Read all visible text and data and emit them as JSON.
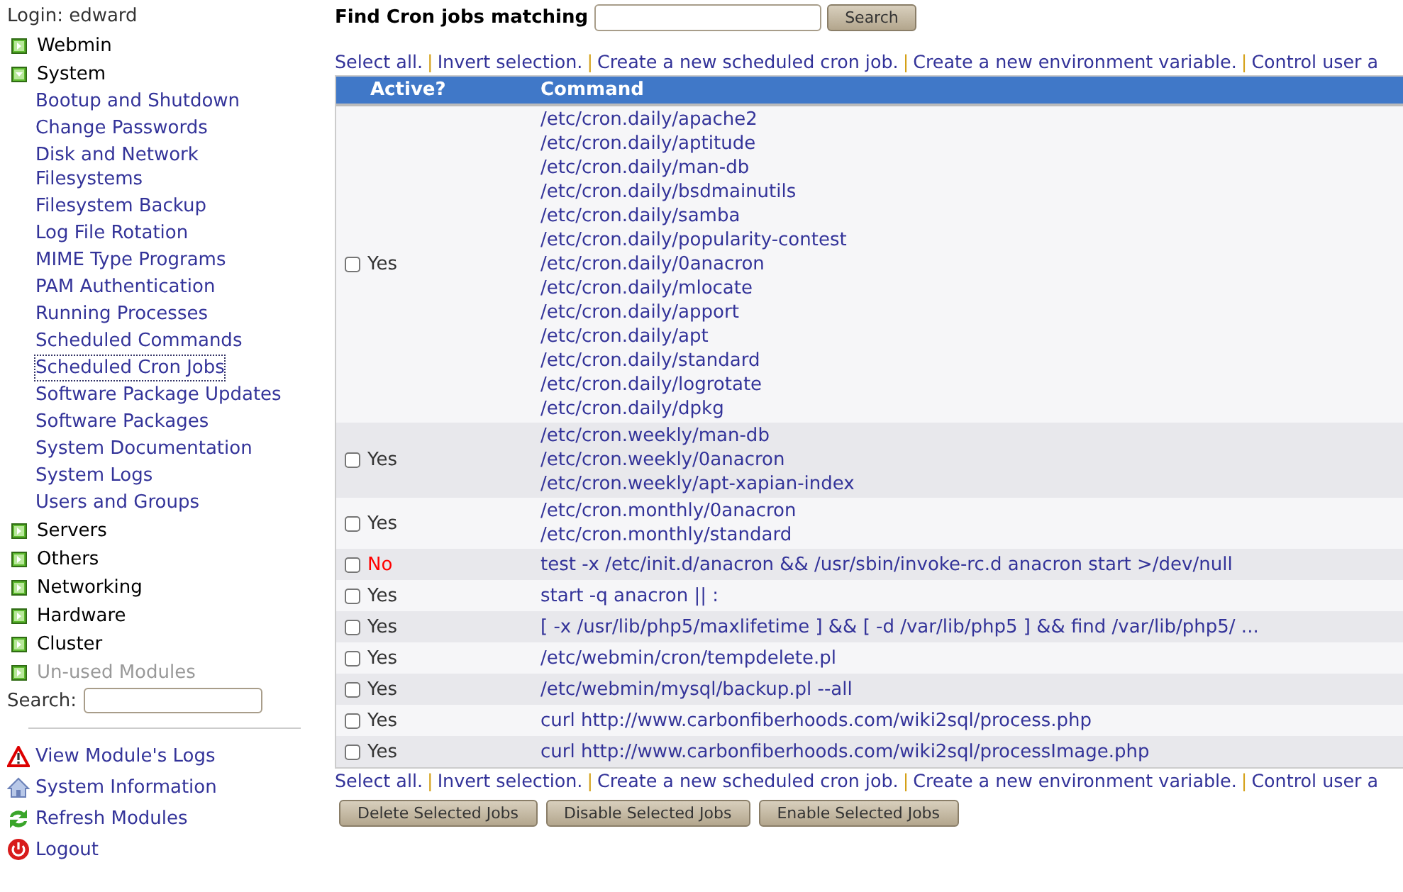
{
  "sidebar": {
    "login": "Login: edward",
    "categories": [
      {
        "label": "Webmin",
        "expanded": false,
        "disabled": false
      },
      {
        "label": "System",
        "expanded": true,
        "disabled": false,
        "children": [
          {
            "label": "Bootup and Shutdown",
            "selected": false
          },
          {
            "label": "Change Passwords",
            "selected": false
          },
          {
            "label": "Disk and Network Filesystems",
            "selected": false
          },
          {
            "label": "Filesystem Backup",
            "selected": false
          },
          {
            "label": "Log File Rotation",
            "selected": false
          },
          {
            "label": "MIME Type Programs",
            "selected": false
          },
          {
            "label": "PAM Authentication",
            "selected": false
          },
          {
            "label": "Running Processes",
            "selected": false
          },
          {
            "label": "Scheduled Commands",
            "selected": false
          },
          {
            "label": "Scheduled Cron Jobs",
            "selected": true
          },
          {
            "label": "Software Package Updates",
            "selected": false
          },
          {
            "label": "Software Packages",
            "selected": false
          },
          {
            "label": "System Documentation",
            "selected": false
          },
          {
            "label": "System Logs",
            "selected": false
          },
          {
            "label": "Users and Groups",
            "selected": false
          }
        ]
      },
      {
        "label": "Servers",
        "expanded": false,
        "disabled": false
      },
      {
        "label": "Others",
        "expanded": false,
        "disabled": false
      },
      {
        "label": "Networking",
        "expanded": false,
        "disabled": false
      },
      {
        "label": "Hardware",
        "expanded": false,
        "disabled": false
      },
      {
        "label": "Cluster",
        "expanded": false,
        "disabled": false
      },
      {
        "label": "Un-used Modules",
        "expanded": false,
        "disabled": true
      }
    ],
    "search_label": "Search:",
    "links": [
      {
        "kind": "warning",
        "label": "View Module's Logs"
      },
      {
        "kind": "home",
        "label": "System Information"
      },
      {
        "kind": "refresh",
        "label": "Refresh Modules"
      },
      {
        "kind": "power",
        "label": "Logout"
      }
    ]
  },
  "find": {
    "label": "Find Cron jobs matching",
    "button": "Search"
  },
  "link_separator": "|",
  "action_links_top": [
    "Select all.",
    "Invert selection.",
    "Create a new scheduled cron job.",
    "Create a new environment variable.",
    "Control user a"
  ],
  "table": {
    "columns": [
      "Active?",
      "Command"
    ],
    "rows": [
      {
        "checked": false,
        "active": true,
        "active_label": "Yes",
        "commands": [
          "/etc/cron.daily/apache2",
          "/etc/cron.daily/aptitude",
          "/etc/cron.daily/man-db",
          "/etc/cron.daily/bsdmainutils",
          "/etc/cron.daily/samba",
          "/etc/cron.daily/popularity-contest",
          "/etc/cron.daily/0anacron",
          "/etc/cron.daily/mlocate",
          "/etc/cron.daily/apport",
          "/etc/cron.daily/apt",
          "/etc/cron.daily/standard",
          "/etc/cron.daily/logrotate",
          "/etc/cron.daily/dpkg"
        ]
      },
      {
        "checked": false,
        "active": true,
        "active_label": "Yes",
        "commands": [
          "/etc/cron.weekly/man-db",
          "/etc/cron.weekly/0anacron",
          "/etc/cron.weekly/apt-xapian-index"
        ]
      },
      {
        "checked": false,
        "active": true,
        "active_label": "Yes",
        "commands": [
          "/etc/cron.monthly/0anacron",
          "/etc/cron.monthly/standard"
        ]
      },
      {
        "checked": false,
        "active": false,
        "active_label": "No",
        "commands": [
          "test -x /etc/init.d/anacron && /usr/sbin/invoke-rc.d anacron start >/dev/null"
        ]
      },
      {
        "checked": false,
        "active": true,
        "active_label": "Yes",
        "commands": [
          "start -q anacron || :"
        ]
      },
      {
        "checked": false,
        "active": true,
        "active_label": "Yes",
        "commands": [
          "[ -x /usr/lib/php5/maxlifetime ] && [ -d /var/lib/php5 ] && find /var/lib/php5/ ..."
        ]
      },
      {
        "checked": false,
        "active": true,
        "active_label": "Yes",
        "commands": [
          "/etc/webmin/cron/tempdelete.pl"
        ]
      },
      {
        "checked": false,
        "active": true,
        "active_label": "Yes",
        "commands": [
          "/etc/webmin/mysql/backup.pl --all"
        ]
      },
      {
        "checked": false,
        "active": true,
        "active_label": "Yes",
        "commands": [
          "curl http://www.carbonfiberhoods.com/wiki2sql/process.php"
        ]
      },
      {
        "checked": false,
        "active": true,
        "active_label": "Yes",
        "commands": [
          "curl http://www.carbonfiberhoods.com/wiki2sql/processImage.php"
        ]
      }
    ]
  },
  "action_links_bottom": [
    "Select all.",
    "Invert selection.",
    "Create a new scheduled cron job.",
    "Create a new environment variable.",
    "Control user a"
  ],
  "buttons": [
    "Delete Selected Jobs",
    "Disable Selected Jobs",
    "Enable Selected Jobs"
  ]
}
